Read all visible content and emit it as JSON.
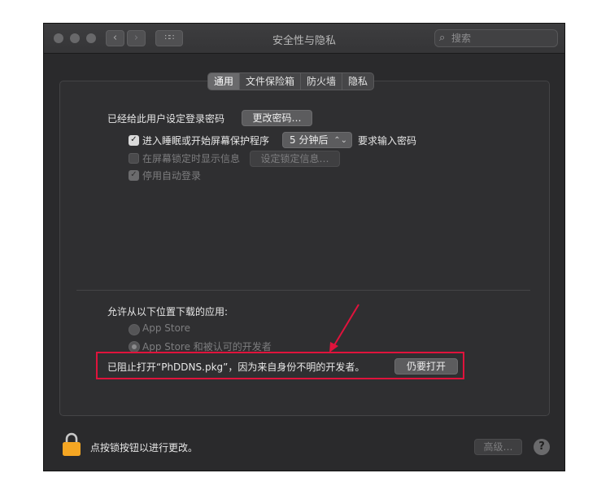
{
  "window": {
    "title": "安全性与隐私",
    "search_placeholder": "搜索"
  },
  "toolbar": {
    "back_icon": "‹",
    "forward_icon": "›",
    "grid_icon": "∷∷"
  },
  "tabs": [
    "通用",
    "文件保险箱",
    "防火墙",
    "隐私"
  ],
  "active_tab": "通用",
  "general": {
    "password_label": "已经给此用户设定登录密码",
    "change_password_button": "更改密码…",
    "sleep_checkbox_label": "进入睡眠或开始屏幕保护程序",
    "sleep_checkbox_checked": true,
    "sleep_delay_value": "5 分钟后",
    "require_password_label": "要求输入密码",
    "lock_message_label": "在屏幕锁定时显示信息",
    "lock_message_checked": false,
    "set_lock_message_button": "设定锁定信息…",
    "disable_autologin_label": "停用自动登录",
    "disable_autologin_checked": true
  },
  "downloads": {
    "heading": "允许从以下位置下载的应用:",
    "option_app_store": "App Store",
    "option_app_store_identified": "App Store 和被认可的开发者",
    "selected_option": "App Store 和被认可的开发者",
    "blocked_message": "已阻止打开“PhDDNS.pkg”，因为来自身份不明的开发者。",
    "open_anyway_button": "仍要打开"
  },
  "footer": {
    "lock_text": "点按锁按钮以进行更改。",
    "advanced_button": "高级…",
    "help_button": "?"
  },
  "colors": {
    "annotation": "#e0133c",
    "window_bg": "#2a2a2c",
    "lock": "#f5a623"
  }
}
